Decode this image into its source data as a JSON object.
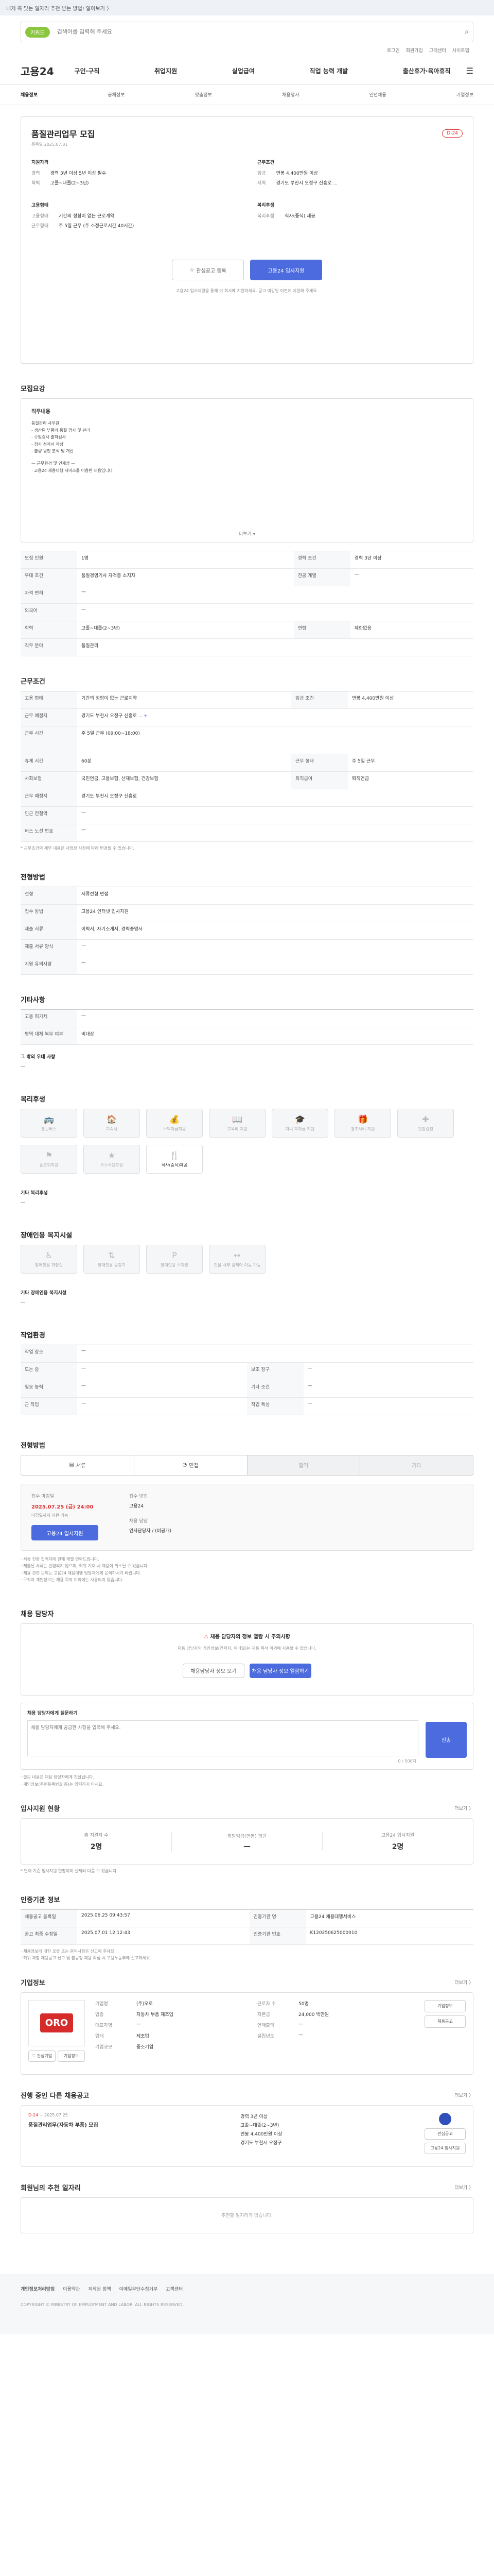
{
  "topbar": {
    "notice": "내게 꼭 맞는 일자리 추천 받는 방법! 알아보기 〉"
  },
  "search": {
    "pill": "키워드",
    "placeholder": "검색어를 입력해 주세요"
  },
  "links": [
    "로그인",
    "회원가입",
    "고객센터",
    "사이트맵"
  ],
  "header": {
    "logo": "고용24",
    "menu": [
      "구인·구직",
      "취업지원",
      "실업급여",
      "직업 능력 개발",
      "출산휴가·육아휴직"
    ]
  },
  "subnav": {
    "items": [
      "채용정보",
      "공채정보",
      "맞춤정보",
      "채용행사",
      "인턴채용",
      "기업정보"
    ],
    "active": 0
  },
  "job": {
    "title": "품질관리업무 모집",
    "dday": "D-24",
    "posted": "등록일 2025.07.01",
    "summary": [
      {
        "label": "지원자격",
        "items": [
          [
            "경력",
            "경력 3년 이상 5년 이상 필수"
          ],
          [
            "학력",
            "고졸~대졸(2~3년)"
          ]
        ]
      },
      {
        "label": "근무조건",
        "items": [
          [
            "임금",
            "연봉 4,400만원 이상"
          ],
          [
            "지역",
            "경기도 부천시 오정구 신흥로 ..."
          ]
        ]
      },
      {
        "label": "고용형태",
        "items": [
          [
            "고용형태",
            "기간의 정함이 없는 근로계약"
          ],
          [
            "근무형태",
            "주 5일 근무 (주 소정근로시간 40시간)"
          ]
        ]
      },
      {
        "label": "복리후생",
        "items": [
          [
            "복리후생",
            "식사(중식) 제공"
          ]
        ]
      }
    ],
    "btn_scrap": "관심공고 등록",
    "btn_apply": "고용24 입사지원",
    "apply_note": "고용24 입사지원을 통해 이 회사에 지원하세요. 공고 마감일 이전에 지원해 주세요."
  },
  "recruit": {
    "title": "모집요강",
    "header": "직무내용",
    "duties": [
      "품질관리 사무원",
      "- 생산된 부품의 품질 검사 및 관리",
      "- 수입검사 출하검사",
      "- 검사 성적서 작성",
      "- 불량 원인 분석 및 개선",
      "",
      "— 근무환경 및 인재상 —",
      "· 고용24 채용대행 서비스를 이용한 채용입니다",
      "· 해당 직무 경력자 우대"
    ],
    "more": "더보기 ▾",
    "rows": [
      [
        "모집 인원",
        "1명",
        "경력 조건",
        "경력 3년 이상"
      ],
      [
        "우대 조건",
        "품질경영기사 자격증 소지자",
        "전공 계열",
        "—"
      ],
      [
        "자격 면허",
        "—",
        "",
        ""
      ],
      [
        "외국어",
        "—",
        "",
        ""
      ],
      [
        "학력",
        "고졸~대졸(2~3년)",
        "연령",
        "제한없음"
      ],
      [
        "직무 분야",
        "품질관리",
        "",
        ""
      ]
    ]
  },
  "cond": {
    "title": "근무조건",
    "rows": [
      [
        "고용 형태",
        "기간의 정함이 없는 근로계약",
        "임금 조건",
        "연봉 4,400만원 이상"
      ],
      [
        "근무 예정지",
        "경기도 부천시 오정구 신흥로 ...",
        "",
        ""
      ],
      [
        "근무 시간",
        "주 5일 근무 (09:00~18:00)",
        "",
        ""
      ],
      [
        "휴게 시간",
        "60분",
        "근무 형태",
        "주 5일 근무"
      ],
      [
        "사회보험",
        "국민연금, 고용보험, 산재보험, 건강보험",
        "퇴직급여",
        "퇴직연금"
      ],
      [
        "근무 예정지",
        "경기도 부천시 오정구 신흥로",
        "",
        ""
      ],
      [
        "인근 전철역",
        "—",
        "",
        ""
      ],
      [
        "버스 노선 번호",
        "—",
        "",
        ""
      ]
    ],
    "note": "* 근무조건의 세부 내용은 사업장 사정에 따라 변경될 수 있습니다."
  },
  "screen": {
    "title": "전형방법",
    "rows": [
      [
        "전형",
        "서류전형 면접"
      ],
      [
        "접수 방법",
        "고용24 인터넷 입사지원"
      ],
      [
        "제출 서류",
        "이력서, 자기소개서, 경력증명서"
      ],
      [
        "제출 서류 양식",
        "—"
      ],
      [
        "지원 유의사항",
        "—"
      ]
    ]
  },
  "etc": {
    "title": "기타사항",
    "rows": [
      [
        "고용 허가제",
        "—"
      ],
      [
        "병역 대체 복무 여부",
        "비대상"
      ]
    ],
    "more_title": "그 밖의 우대 사항",
    "more_val": "—"
  },
  "welfare": {
    "title": "복리후생",
    "items": [
      "통근버스",
      "기숙사",
      "주택자금지원",
      "교육비 지원",
      "자녀 학자금 지원",
      "경조사비 지원",
      "건강검진",
      "동호회지원",
      "우수사원포상",
      "식사(중식)제공"
    ],
    "active": [
      9
    ],
    "other_title": "기타 복리후생",
    "other_val": "—"
  },
  "disabled": {
    "title": "장애인용 복지시설",
    "items": [
      "장애인용 화장실",
      "장애인용 승강기",
      "장애인용 주차장",
      "건물 내부 휠체어 이동 가능"
    ],
    "other_title": "기타 장애인용 복지시설",
    "other_val": "—"
  },
  "cond2": {
    "title": "작업환경",
    "rows": [
      [
        "작업 장소",
        "—",
        "",
        ""
      ],
      [
        "도는 중",
        "—",
        "보조 장구",
        "—"
      ],
      [
        "필요 능력",
        "—",
        "기타 조건",
        "—"
      ],
      [
        "근 작업",
        "—",
        "작업 특성",
        "—"
      ]
    ]
  },
  "method": {
    "title": "전형방법",
    "steps": [
      "서류",
      "면접",
      "합격",
      "기타"
    ],
    "period_label": "접수 마감일",
    "period": "2025.07.25 (금) 24:00",
    "period_sub": "마감일까지 지원 가능",
    "how_label": "접수 방법",
    "how": "고용24",
    "contact_label": "채용 담당",
    "contact": "인사담당자 / (비공개)",
    "apply": "고용24 입사지원",
    "notes": [
      "· 서류 전형 합격자에 한해 개별 연락드립니다.",
      "· 제출된 서류는 반환되지 않으며, 허위 기재 시 채용이 취소될 수 있습니다.",
      "· 채용 관련 문의는 고용24 채용대행 담당자에게 문의하시기 바랍니다.",
      "· 구직자 개인정보는 채용 목적 이외에는 사용되지 않습니다."
    ]
  },
  "manager": {
    "title": "채용 담당자",
    "alert": "채용 담당자의 정보 열람 시 주의사항",
    "desc": "채용 담당자의 개인정보(연락처, 이메일)는 채용 목적 이외에 사용할 수 없습니다.",
    "btn1": "채용담당자 정보 보기",
    "btn2": "채용 담당자 정보 열람하기",
    "qna_label": "채용 담당자에게 질문하기",
    "qna_placeholder": "채용 담당자에게 궁금한 사항을 입력해 주세요.",
    "qna_btn": "전송",
    "counter": "0 / 500자",
    "qna_notes": [
      "· 질문 내용은 채용 담당자에게 전달됩니다.",
      "· 개인정보(주민등록번호 등)는 입력하지 마세요."
    ]
  },
  "stats": {
    "title": "입사지원 현황",
    "more": "더보기 〉",
    "items": [
      [
        "총 지원자 수",
        "2명"
      ],
      [
        "희망임금(연봉) 평균",
        "—"
      ],
      [
        "고용24 입사지원",
        "2명"
      ]
    ],
    "note": "* 현재 기준 입사지원 현황이며 실제와 다를 수 있습니다."
  },
  "info": {
    "title": "인증기관 정보",
    "rows": [
      [
        "채용공고 등록일",
        "2025.06.25 09:43:57",
        "인증기관 명",
        "고용24 채용대행서비스"
      ],
      [
        "공고 최종 수정일",
        "2025.07.01 12:12:43",
        "인증기관 번호",
        "K120250625000010"
      ]
    ],
    "notes": [
      "· 채용정보에 대한 오류 또는 문의사항은 신고해 주세요.",
      "· 허위 과장 채용공고 신고 및 불공정 채용 의심 시 고용노동부에 신고하세요."
    ]
  },
  "company": {
    "title": "기업정보",
    "more": "더보기 〉",
    "logo": "ORO",
    "btn_like": "♡ 관심기업",
    "btn_info": "기업정보",
    "rows": [
      [
        "기업명",
        "(주)오로"
      ],
      [
        "업종",
        "자동차 부품 제조업"
      ],
      [
        "대표자명",
        "—"
      ],
      [
        "업태",
        "제조업"
      ],
      [
        "기업규모",
        "중소기업"
      ]
    ],
    "rows2": [
      [
        "근로자 수",
        "50명"
      ],
      [
        "자본금",
        "24,000 백만원"
      ],
      [
        "연매출액",
        "—"
      ],
      [
        "설립년도",
        "—"
      ]
    ],
    "side": [
      "기업정보",
      "채용공고"
    ]
  },
  "similar": {
    "title": "진행 중인 다른 채용공고",
    "more": "더보기 〉",
    "dday": "D-24",
    "date": "~ 2025.07.25",
    "ttl": "품질관리업무(자동차 부품) 모집",
    "a": "경력 3년 이상",
    "b": "고졸~대졸(2~3년)",
    "pay": "연봉 4,400만원 이상",
    "place": "경기도 부천시 오정구",
    "btns": [
      "관심공고",
      "고용24 입사지원"
    ]
  },
  "recommend": {
    "title": "회원님의 추천 일자리",
    "more": "더보기 〉",
    "empty": "추천할 일자리가 없습니다."
  },
  "footer": {
    "links": [
      "개인정보처리방침",
      "이용약관",
      "저작권 정책",
      "이메일무단수집거부",
      "고객센터"
    ],
    "copy": "COPYRIGHT © MINISTRY OF EMPLOYMENT AND LABOR. ALL RIGHTS RESERVED."
  }
}
